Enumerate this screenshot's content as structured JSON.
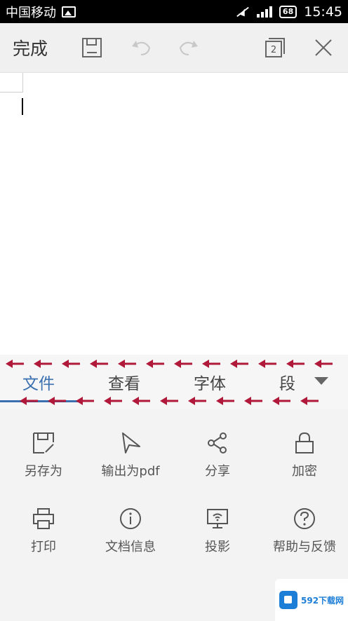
{
  "status_bar": {
    "carrier": "中国移动",
    "battery": "68",
    "time": "15:45"
  },
  "toolbar": {
    "done_label": "完成",
    "window_count": "2"
  },
  "tabs": [
    {
      "label": "文件",
      "active": true
    },
    {
      "label": "查看",
      "active": false
    },
    {
      "label": "字体",
      "active": false
    },
    {
      "label": "段",
      "active": false
    }
  ],
  "actions": [
    {
      "label": "另存为",
      "icon": "save-as-icon"
    },
    {
      "label": "输出为pdf",
      "icon": "export-pdf-icon"
    },
    {
      "label": "分享",
      "icon": "share-icon"
    },
    {
      "label": "加密",
      "icon": "lock-icon"
    },
    {
      "label": "打印",
      "icon": "print-icon"
    },
    {
      "label": "文档信息",
      "icon": "info-icon"
    },
    {
      "label": "投影",
      "icon": "projection-icon"
    },
    {
      "label": "帮助与反馈",
      "icon": "help-icon"
    }
  ],
  "watermark": {
    "text": "592下载网"
  },
  "colors": {
    "accent": "#3a6fb0",
    "arrow": "#b0193a",
    "status_bar": "#000000"
  }
}
